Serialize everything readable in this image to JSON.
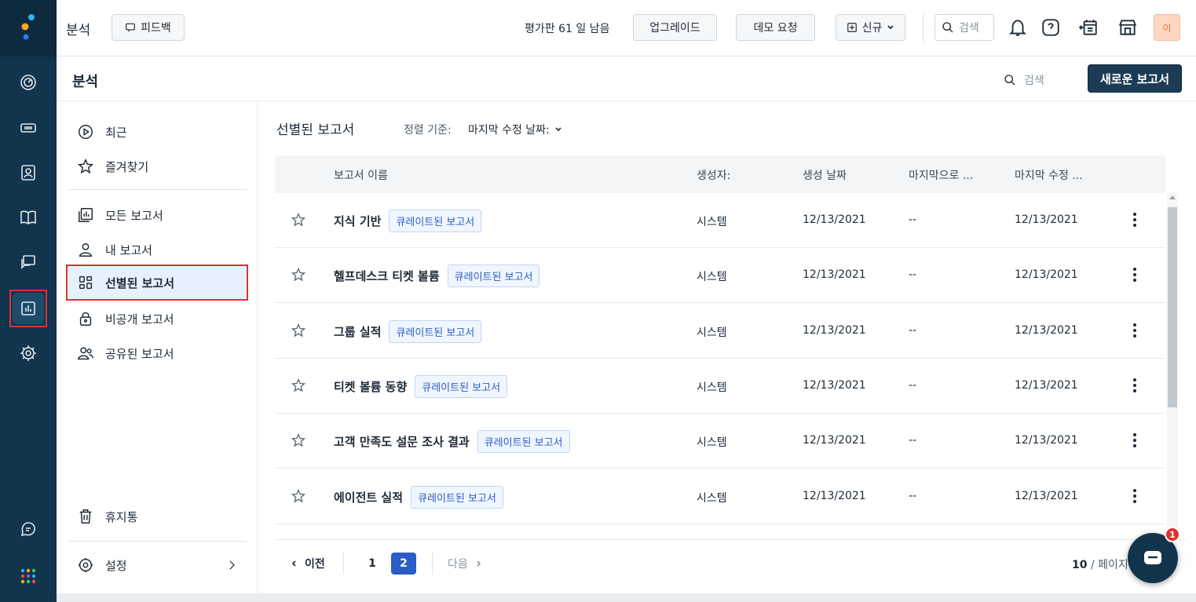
{
  "header": {
    "title": "분석",
    "feedback_label": "피드백",
    "trial_text": "평가판 61 일 남음",
    "upgrade_label": "업그레이드",
    "demo_label": "데모 요청",
    "new_label": "신규",
    "search_placeholder": "검색",
    "avatar_initial": "이"
  },
  "subheader": {
    "title": "분석",
    "search_placeholder": "검색",
    "new_report_label": "새로운 보고서"
  },
  "leftnav": {
    "recent": "최근",
    "favorites": "즐겨찾기",
    "all_reports": "모든 보고서",
    "my_reports": "내 보고서",
    "curated_reports": "선별된 보고서",
    "private_reports": "비공개 보고서",
    "shared_reports": "공유된 보고서",
    "trash": "휴지통",
    "settings": "설정"
  },
  "main": {
    "heading": "선별된 보고서",
    "sort_label": "정렬 기준:",
    "sort_value": "마지막 수정 날짜:",
    "columns": {
      "name": "보고서 이름",
      "creator": "생성자:",
      "created": "생성 날짜",
      "last_viewed": "마지막으로 ...",
      "last_modified": "마지막 수정 ..."
    },
    "rows": [
      {
        "name": "지식 기반",
        "tag": "큐레이트된 보고서",
        "creator": "시스템",
        "created": "12/13/2021",
        "last_viewed": "--",
        "last_modified": "12/13/2021"
      },
      {
        "name": "헬프데스크 티켓 볼륨",
        "tag": "큐레이트된 보고서",
        "creator": "시스템",
        "created": "12/13/2021",
        "last_viewed": "--",
        "last_modified": "12/13/2021"
      },
      {
        "name": "그룹 실적",
        "tag": "큐레이트된 보고서",
        "creator": "시스템",
        "created": "12/13/2021",
        "last_viewed": "--",
        "last_modified": "12/13/2021"
      },
      {
        "name": "티켓 볼륨 동향",
        "tag": "큐레이트된 보고서",
        "creator": "시스템",
        "created": "12/13/2021",
        "last_viewed": "--",
        "last_modified": "12/13/2021"
      },
      {
        "name": "고객 만족도 설문 조사 결과",
        "tag": "큐레이트된 보고서",
        "creator": "시스템",
        "created": "12/13/2021",
        "last_viewed": "--",
        "last_modified": "12/13/2021"
      },
      {
        "name": "에이전트 실적",
        "tag": "큐레이트된 보고서",
        "creator": "시스템",
        "created": "12/13/2021",
        "last_viewed": "--",
        "last_modified": "12/13/2021"
      }
    ],
    "pager": {
      "prev": "이전",
      "page1": "1",
      "page2": "2",
      "next": "다음",
      "per_page_count": "10",
      "per_page_suffix": "/ 페이지"
    }
  },
  "chat": {
    "badge": "1"
  },
  "colors": {
    "rail": "#12344d",
    "primary_button": "#1d3b55",
    "accent_blue": "#2c5cc5",
    "highlight_red": "#e03131",
    "active_nav_bg": "#e5f2fd"
  }
}
